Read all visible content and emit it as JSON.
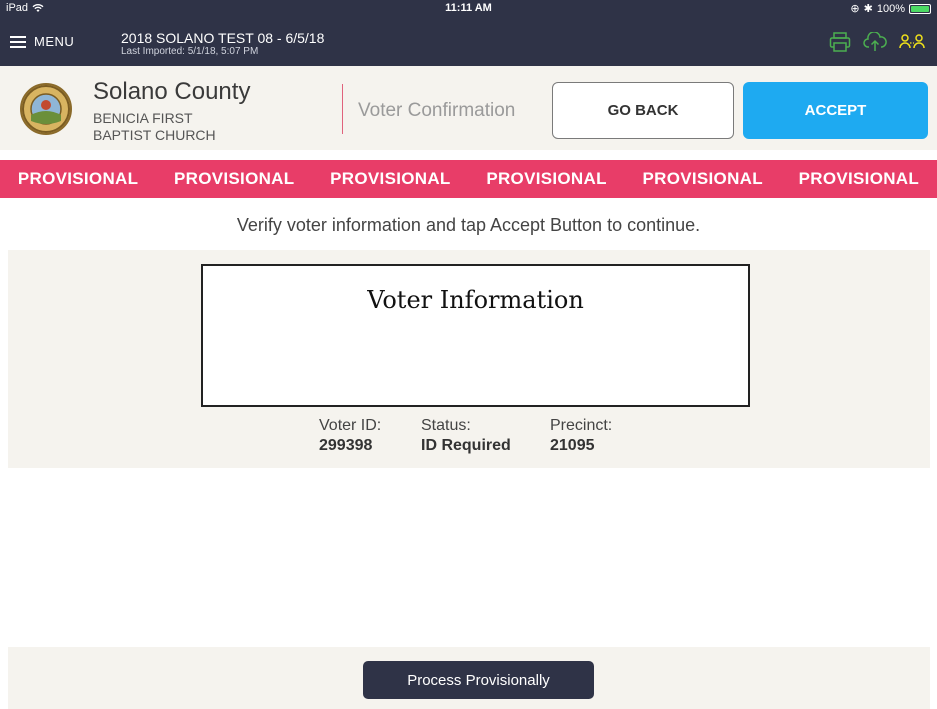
{
  "status_bar": {
    "device": "iPad",
    "time": "11:11 AM",
    "battery": "100%"
  },
  "app_bar": {
    "menu_label": "MENU",
    "title": "2018 SOLANO TEST 08 - 6/5/18",
    "subtitle": "Last Imported: 5/1/18, 5:07 PM",
    "icons": [
      "printer-icon",
      "cloud-upload-icon",
      "users-icon"
    ],
    "icon_colors": {
      "printer": "#4caf50",
      "cloud": "#4caf50",
      "users": "#f0e11a"
    }
  },
  "header": {
    "county": "Solano County",
    "location_line1": "BENICIA FIRST",
    "location_line2": "BAPTIST CHURCH",
    "page_heading": "Voter Confirmation",
    "go_back_label": "GO BACK",
    "accept_label": "ACCEPT"
  },
  "banner": {
    "items": [
      "PROVISIONAL",
      "PROVISIONAL",
      "PROVISIONAL",
      "PROVISIONAL",
      "PROVISIONAL",
      "PROVISIONAL"
    ],
    "color": "#e83d68"
  },
  "instructions": "Verify voter information and tap Accept Button to continue.",
  "voter_info": {
    "title": "Voter Information",
    "voter_id_label": "Voter ID:",
    "voter_id": "299398",
    "status_label": "Status:",
    "status": "ID Required",
    "precinct_label": "Precinct:",
    "precinct": "21095"
  },
  "footer": {
    "process_label": "Process Provisionally"
  },
  "colors": {
    "dark": "#2f3347",
    "accent_blue": "#1eaaf1",
    "provisional_red": "#e83d68",
    "panel_beige": "#f5f3ee"
  }
}
